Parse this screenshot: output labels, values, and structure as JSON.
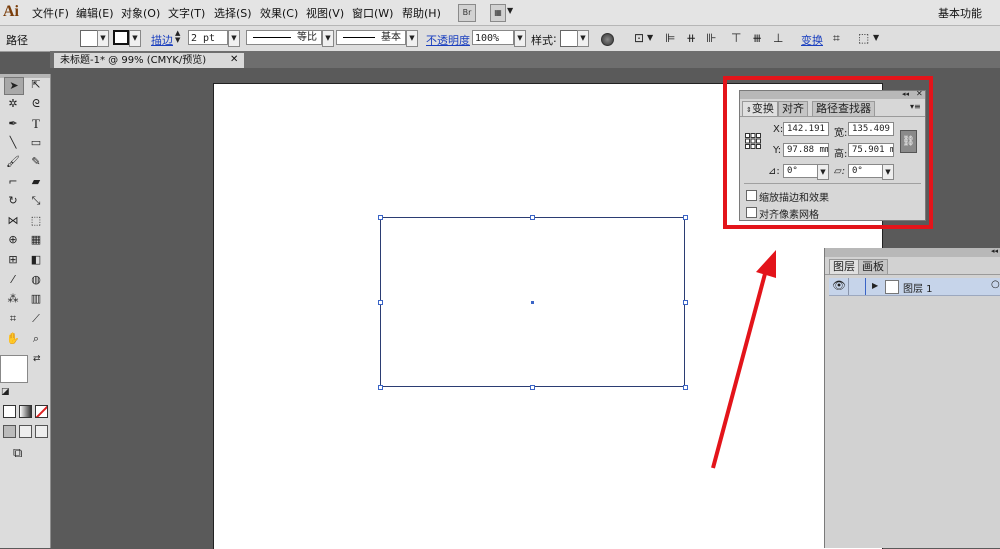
{
  "app": {
    "logo_text": "Ai",
    "workspace": "基本功能"
  },
  "menu": [
    "文件(F)",
    "编辑(E)",
    "对象(O)",
    "文字(T)",
    "选择(S)",
    "效果(C)",
    "视图(V)",
    "窗口(W)",
    "帮助(H)"
  ],
  "menu_buttons": {
    "bridge": "Br"
  },
  "controlbar": {
    "object_type": "路径",
    "stroke_label": "描边",
    "stroke_value": "2 pt",
    "profile_label": "等比",
    "brush_label": "基本",
    "opacity_label": "不透明度",
    "opacity_value": "100%",
    "style_label": "样式",
    "transform_link": "变换"
  },
  "document": {
    "tab_title": "未标题-1* @ 99% (CMYK/预览)"
  },
  "transform_panel": {
    "tabs": [
      "变换",
      "对齐",
      "路径查找器"
    ],
    "x_label": "X:",
    "x_value": "142.191",
    "y_label": "Y:",
    "y_value": "97.88 mm",
    "w_label": "宽:",
    "w_value": "135.409",
    "h_label": "高:",
    "h_value": "75.901 m",
    "rotate_value": "0°",
    "shear_value": "0°",
    "scale_strokes_label": "缩放描边和效果",
    "align_pixel_label": "对齐像素网格"
  },
  "layers_panel": {
    "tabs": [
      "图层",
      "画板"
    ],
    "layer_name": "图层 1"
  },
  "colors": {
    "highlight": "#e3141a",
    "selection": "#3a64c6",
    "layer_row": "#c6d4ea"
  }
}
